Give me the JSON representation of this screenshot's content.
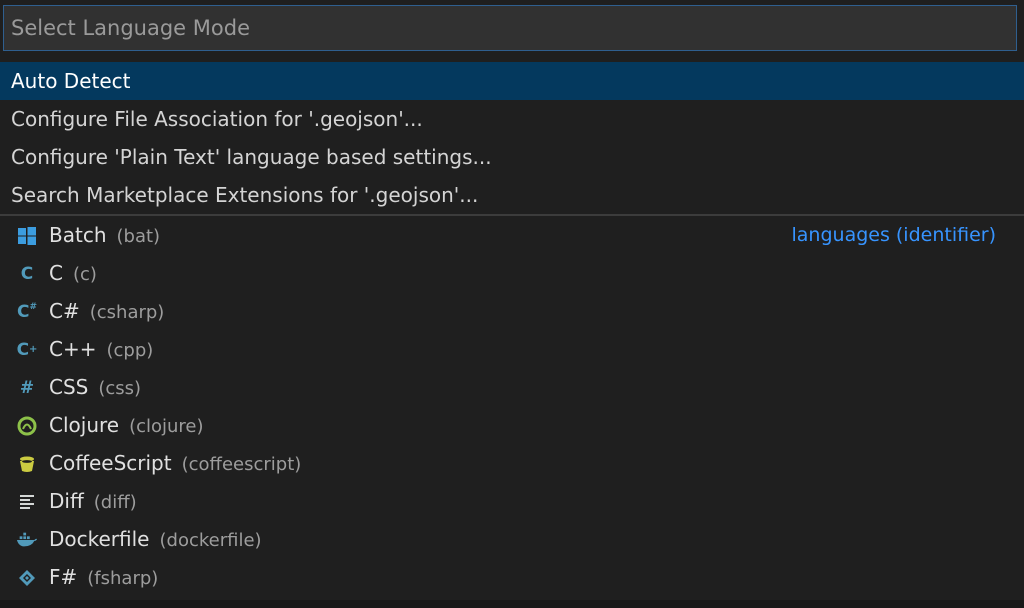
{
  "search": {
    "placeholder": "Select Language Mode",
    "value": ""
  },
  "actions": [
    {
      "label": "Auto Detect",
      "selected": true
    },
    {
      "label": "Configure File Association for '.geojson'..."
    },
    {
      "label": "Configure 'Plain Text' language based settings..."
    },
    {
      "label": "Search Marketplace Extensions for '.geojson'..."
    }
  ],
  "group_label": "languages (identifier)",
  "languages": [
    {
      "name": "Batch",
      "id": "(bat)",
      "icon": "windows-icon",
      "color": "#3c9de0"
    },
    {
      "name": "C",
      "id": "(c)",
      "icon": "c-icon",
      "color": "#519aba"
    },
    {
      "name": "C#",
      "id": "(csharp)",
      "icon": "csharp-icon",
      "color": "#519aba"
    },
    {
      "name": "C++",
      "id": "(cpp)",
      "icon": "cpp-icon",
      "color": "#519aba"
    },
    {
      "name": "CSS",
      "id": "(css)",
      "icon": "hash-icon",
      "color": "#519aba"
    },
    {
      "name": "Clojure",
      "id": "(clojure)",
      "icon": "clojure-icon",
      "color": "#8dc149"
    },
    {
      "name": "CoffeeScript",
      "id": "(coffeescript)",
      "icon": "coffee-icon",
      "color": "#cbcb41"
    },
    {
      "name": "Diff",
      "id": "(diff)",
      "icon": "diff-icon",
      "color": "#d4d7d6"
    },
    {
      "name": "Dockerfile",
      "id": "(dockerfile)",
      "icon": "docker-icon",
      "color": "#519aba"
    },
    {
      "name": "F#",
      "id": "(fsharp)",
      "icon": "fsharp-icon",
      "color": "#519aba"
    }
  ]
}
